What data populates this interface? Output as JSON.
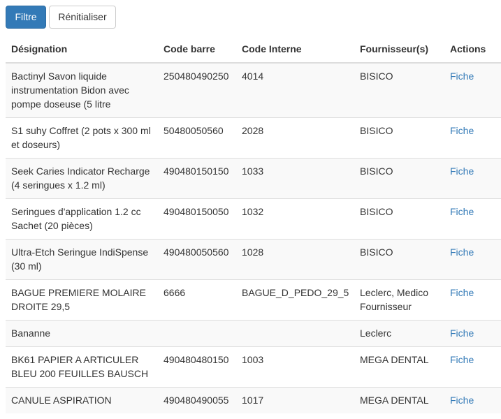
{
  "toolbar": {
    "filter_label": "Filtre",
    "reset_label": "Rénitialiser"
  },
  "table": {
    "headers": [
      "Désignation",
      "Code barre",
      "Code Interne",
      "Fournisseur(s)",
      "Actions"
    ],
    "rows": [
      {
        "designation": "Bactinyl Savon liquide instrumentation Bidon avec pompe doseuse (5 litre",
        "barcode": "250480490250",
        "internal": "4014",
        "supplier": "BISICO",
        "action": "Fiche"
      },
      {
        "designation": "S1 suhy Coffret (2 pots x 300 ml et doseurs)",
        "barcode": "50480050560",
        "internal": "2028",
        "supplier": "BISICO",
        "action": "Fiche"
      },
      {
        "designation": "Seek Caries Indicator Recharge (4 seringues x 1.2 ml)",
        "barcode": "490480150150",
        "internal": "1033",
        "supplier": "BISICO",
        "action": "Fiche"
      },
      {
        "designation": "Seringues d'application 1.2 cc Sachet (20 pièces)",
        "barcode": "490480150050",
        "internal": "1032",
        "supplier": "BISICO",
        "action": "Fiche"
      },
      {
        "designation": "Ultra-Etch Seringue IndiSpense (30 ml)",
        "barcode": "490480050560",
        "internal": "1028",
        "supplier": "BISICO",
        "action": "Fiche"
      },
      {
        "designation": "BAGUE PREMIERE MOLAIRE DROITE 29,5",
        "barcode": "6666",
        "internal": "BAGUE_D_PEDO_29_5",
        "supplier": "Leclerc, Medico Fournisseur",
        "action": "Fiche"
      },
      {
        "designation": "Bananne",
        "barcode": "",
        "internal": "",
        "supplier": "Leclerc",
        "action": "Fiche"
      },
      {
        "designation": "BK61 PAPIER A ARTICULER BLEU 200 FEUILLES BAUSCH",
        "barcode": "490480480150",
        "internal": "1003",
        "supplier": "MEGA DENTAL",
        "action": "Fiche"
      },
      {
        "designation": "CANULE ASPIRATION",
        "barcode": "490480490055",
        "internal": "1017",
        "supplier": "MEGA DENTAL",
        "action": "Fiche"
      }
    ]
  }
}
